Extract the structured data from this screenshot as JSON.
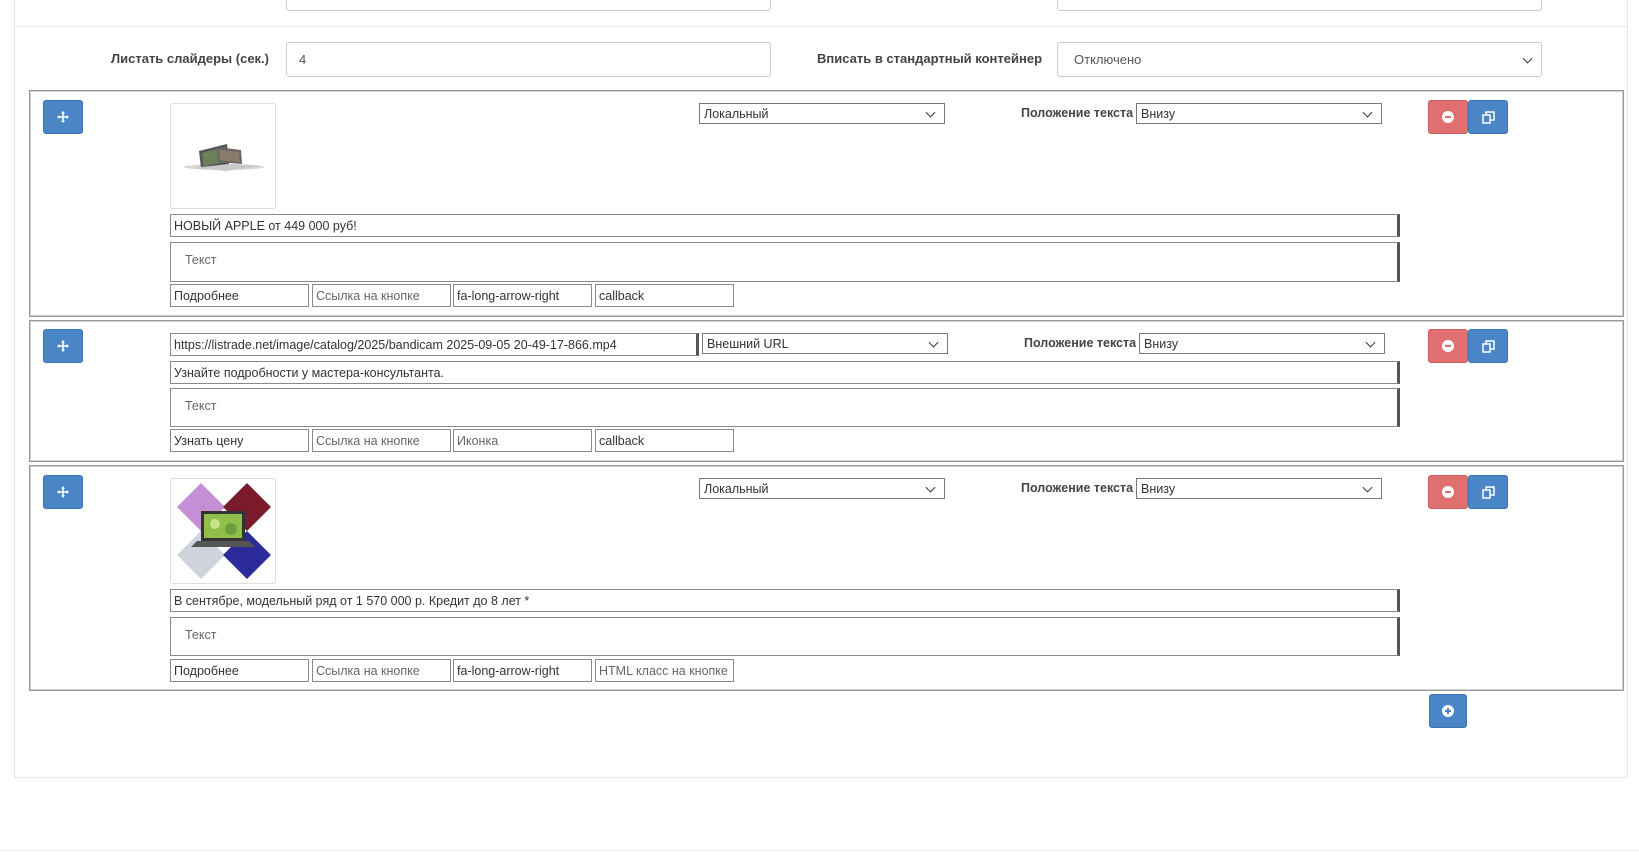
{
  "settings": {
    "scroll_label": "Листать слайдеры (сек.)",
    "scroll_value": "4",
    "fit_label": "Вписать в стандартный контейнер",
    "fit_value": "Отключено"
  },
  "slides": [
    {
      "source_type": "Локальный",
      "text_position_label": "Положение текста",
      "text_position": "Внизу",
      "title": "НОВЫЙ APPLE от 449 000 руб!",
      "text_placeholder": "Текст",
      "button_label": "Подробнее",
      "button_link_placeholder": "Ссылка на кнопке",
      "icon": "fa-long-arrow-right",
      "html_class": "callback"
    },
    {
      "url": "https://listrade.net/image/catalog/2025/bandicam 2025-09-05 20-49-17-866.mp4",
      "source_type": "Внешний URL",
      "text_position_label": "Положение текста",
      "text_position": "Внизу",
      "title": "Узнайте подробности у мастера-консультанта.",
      "text_placeholder": "Текст",
      "button_label": "Узнать цену",
      "button_link_placeholder": "Ссылка на кнопке",
      "icon_placeholder": "Иконка",
      "html_class": "callback"
    },
    {
      "source_type": "Локальный",
      "text_position_label": "Положение текста",
      "text_position": "Внизу",
      "title": "В сентябре, модельный ряд от  1 570 000 р. Кредит до 8 лет *",
      "text_placeholder": "Текст",
      "button_label": "Подробнее",
      "button_link_placeholder": "Ссылка на кнопке",
      "icon": "fa-long-arrow-right",
      "html_class_placeholder": "HTML класс на кнопке"
    }
  ],
  "icons": {
    "move": "arrows-move-icon",
    "remove": "minus-circle-icon",
    "copy": "copy-icon",
    "add": "plus-circle-icon"
  },
  "colors": {
    "blue_button": "#4a86c5",
    "red_button": "#e06f6f"
  }
}
